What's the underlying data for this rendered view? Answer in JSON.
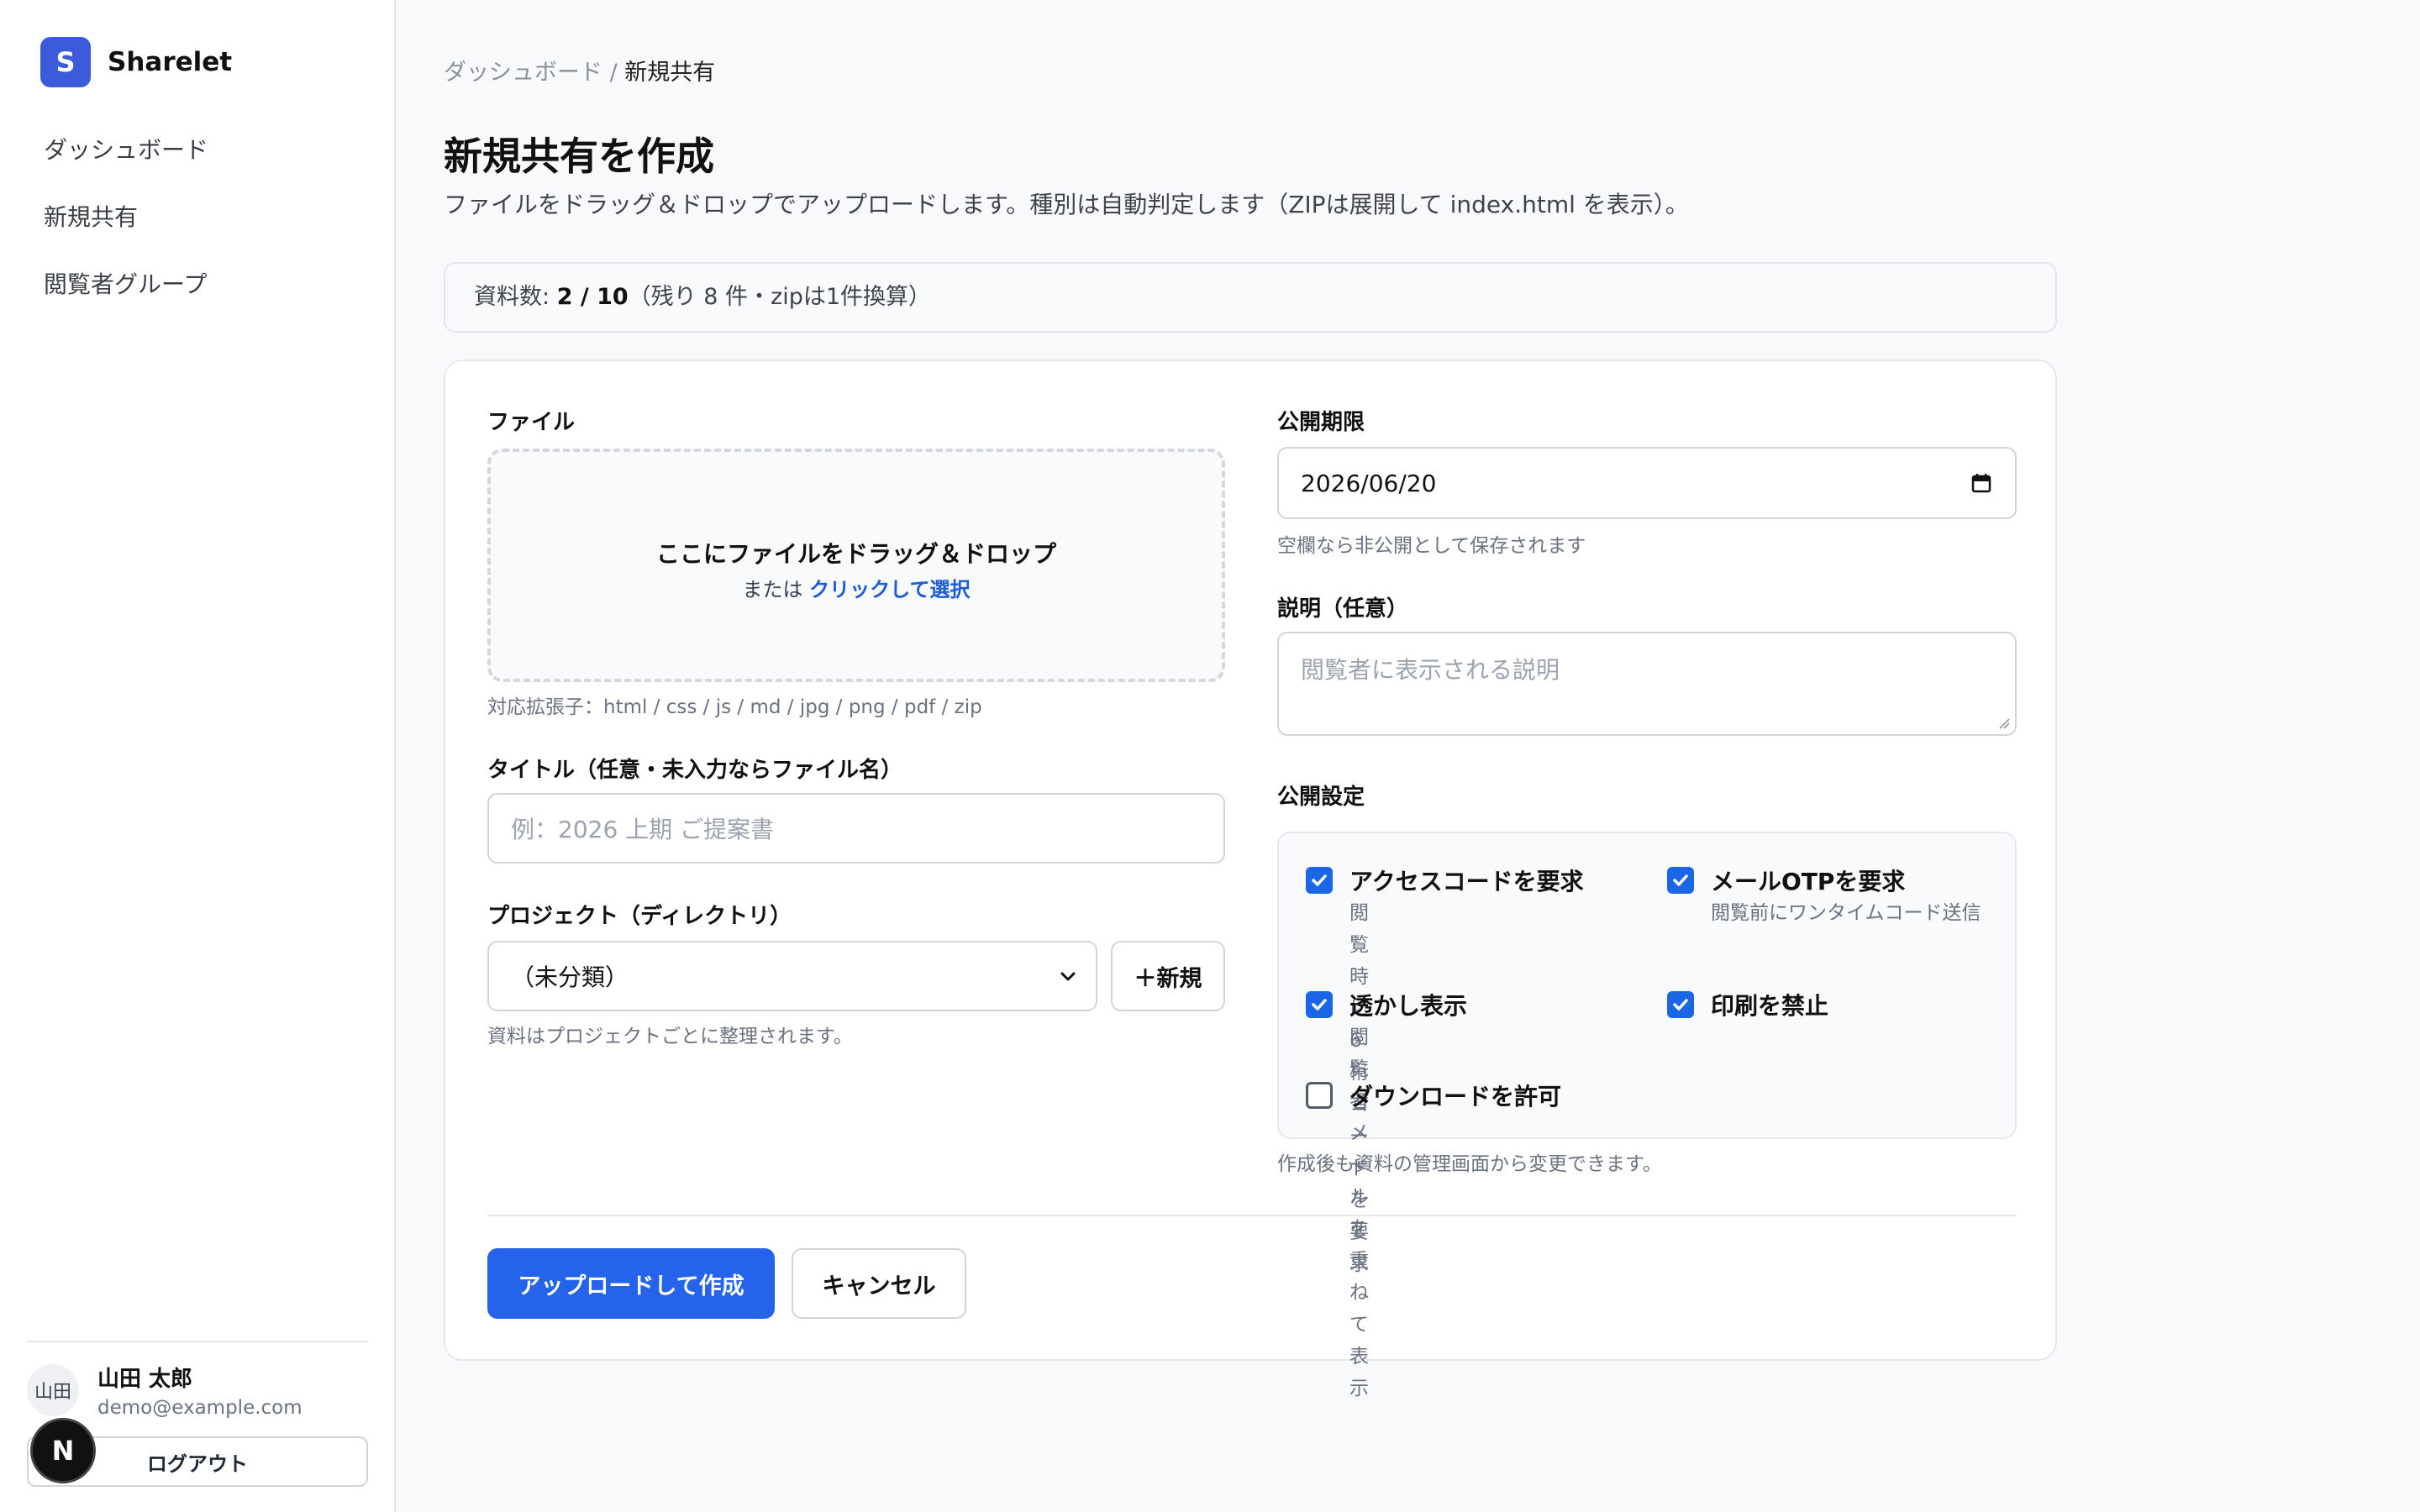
{
  "brand": {
    "logo_letter": "S",
    "name": "Sharelet",
    "accent": "#3b5bdb"
  },
  "sidebar": {
    "items": [
      {
        "label": "ダッシュボード"
      },
      {
        "label": "新規共有"
      },
      {
        "label": "閲覧者グループ"
      }
    ],
    "user": {
      "avatar_text": "山田",
      "name": "山田 太郎",
      "email": "demo@example.com"
    },
    "logout_label": "ログアウト",
    "floating_badge": "N"
  },
  "breadcrumb": {
    "parent": "ダッシュボード",
    "separator": " / ",
    "current": "新規共有"
  },
  "page": {
    "title": "新規共有を作成",
    "description": "ファイルをドラッグ＆ドロップでアップロードします。種別は自動判定します（ZIPは展開して index.html を表示）。"
  },
  "quota": {
    "prefix": "資料数: ",
    "count": "2 / 10",
    "suffix": "（残り 8 件・zipは1件換算）"
  },
  "form": {
    "file": {
      "label": "ファイル",
      "drop_title": "ここにファイルをドラッグ＆ドロップ",
      "drop_or": "または ",
      "drop_link": "クリックして選択",
      "extensions_hint": "対応拡張子：html / css / js / md / jpg / png / pdf / zip"
    },
    "title": {
      "label": "タイトル（任意・未入力ならファイル名）",
      "placeholder": "例：2026 上期 ご提案書",
      "value": ""
    },
    "project": {
      "label": "プロジェクト（ディレクトリ）",
      "selected": "（未分類）",
      "new_button": "＋新規",
      "hint": "資料はプロジェクトごとに整理されます。"
    },
    "expiry": {
      "label": "公開期限",
      "value": "2026/06/20",
      "hint": "空欄なら非公開として保存されます"
    },
    "description": {
      "label": "説明（任意）",
      "placeholder": "閲覧者に表示される説明"
    },
    "settings": {
      "label": "公開設定",
      "options": [
        {
          "title": "アクセスコードを要求",
          "desc": "閲覧時に6桁コードを要求",
          "checked": true
        },
        {
          "title": "メールOTPを要求",
          "desc": "閲覧前にワンタイムコード送信",
          "checked": true
        },
        {
          "title": "透かし表示",
          "desc": "閲覧者メールを重ねて表示",
          "checked": true
        },
        {
          "title": "印刷を禁止",
          "desc": "",
          "checked": true
        },
        {
          "title": "ダウンロードを許可",
          "desc": "",
          "checked": false
        }
      ],
      "hint": "作成後も資料の管理画面から変更できます。"
    },
    "submit_label": "アップロードして作成",
    "cancel_label": "キャンセル"
  }
}
